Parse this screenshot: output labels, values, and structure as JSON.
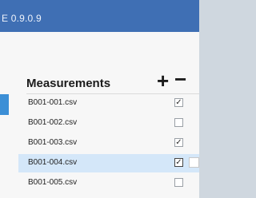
{
  "window": {
    "title": "E 0.9.0.9"
  },
  "panel": {
    "heading": "Measurements",
    "add_label": "+",
    "remove_label": "−",
    "files": [
      {
        "name": "B001-001.csv",
        "checked": true,
        "selected": false,
        "check_mark": "✓"
      },
      {
        "name": "B001-002.csv",
        "checked": false,
        "selected": false,
        "check_mark": ""
      },
      {
        "name": "B001-003.csv",
        "checked": true,
        "selected": false,
        "check_mark": "✓"
      },
      {
        "name": "B001-004.csv",
        "checked": true,
        "selected": true,
        "check_mark": "✓"
      },
      {
        "name": "B001-005.csv",
        "checked": false,
        "selected": false,
        "check_mark": ""
      }
    ]
  }
}
